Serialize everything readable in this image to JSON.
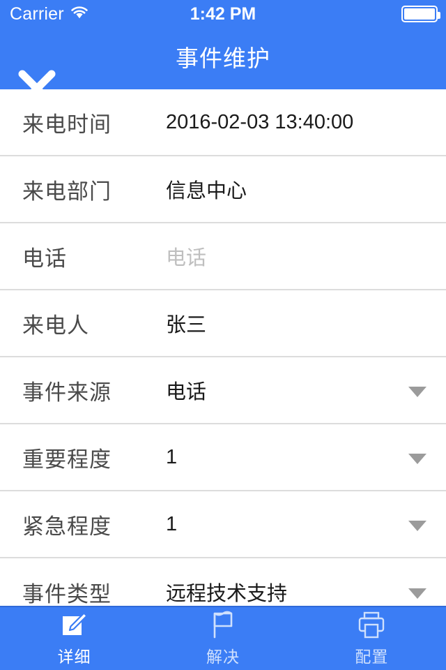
{
  "status_bar": {
    "carrier": "Carrier",
    "wifi_icon": "wifi-icon",
    "time": "1:42 PM",
    "battery_icon": "battery-full-icon"
  },
  "nav_bar": {
    "title": "事件维护",
    "close_icon": "close-icon"
  },
  "colors": {
    "brand_blue": "#3B7DF5",
    "separator": "#dcdcdc",
    "label_text": "#4a4a4a",
    "value_text": "#1a1a1a",
    "placeholder_text": "#bfbfbf",
    "caret": "#9b9b9b",
    "tab_inactive_label": "#cfe0fd"
  },
  "form": {
    "rows": [
      {
        "label": "来电时间",
        "value": "2016-02-03 13:40:00",
        "is_placeholder": false,
        "has_caret": false
      },
      {
        "label": "来电部门",
        "value": "信息中心",
        "is_placeholder": false,
        "has_caret": false
      },
      {
        "label": "电话",
        "value": "电话",
        "is_placeholder": true,
        "has_caret": false
      },
      {
        "label": "来电人",
        "value": "张三",
        "is_placeholder": false,
        "has_caret": false
      },
      {
        "label": "事件来源",
        "value": "电话",
        "is_placeholder": false,
        "has_caret": true
      },
      {
        "label": "重要程度",
        "value": "1",
        "is_placeholder": false,
        "has_caret": true
      },
      {
        "label": "紧急程度",
        "value": "1",
        "is_placeholder": false,
        "has_caret": true
      },
      {
        "label": "事件类型",
        "value": "远程技术支持",
        "is_placeholder": false,
        "has_caret": true
      }
    ]
  },
  "tab_bar": {
    "tabs": [
      {
        "label": "详细",
        "icon": "edit-square-icon",
        "active": true
      },
      {
        "label": "解决",
        "icon": "flag-icon",
        "active": false
      },
      {
        "label": "配置",
        "icon": "printer-icon",
        "active": false
      }
    ]
  }
}
